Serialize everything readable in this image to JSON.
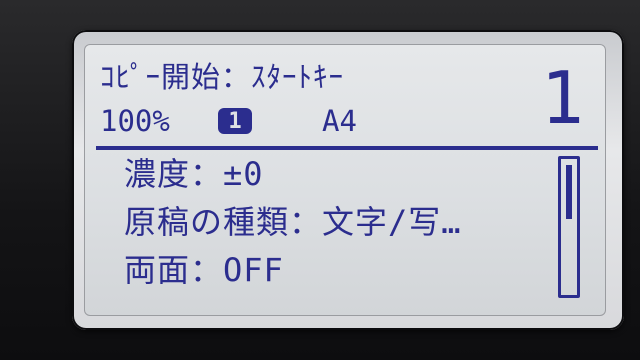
{
  "status": {
    "title": "ｺﾋﾟｰ開始：ｽﾀｰﾄｷｰ",
    "zoom": "100%",
    "tray": "1",
    "paper_size": "A4",
    "copies": "1"
  },
  "menu": {
    "items": [
      {
        "label": "濃度：±0"
      },
      {
        "label": "原稿の種類：文字/写…"
      },
      {
        "label": "両面：OFF"
      }
    ],
    "scroll_position": 0.0
  },
  "colors": {
    "lcd_text": "#2b2d8e",
    "lcd_background": "#dcdfe2"
  }
}
